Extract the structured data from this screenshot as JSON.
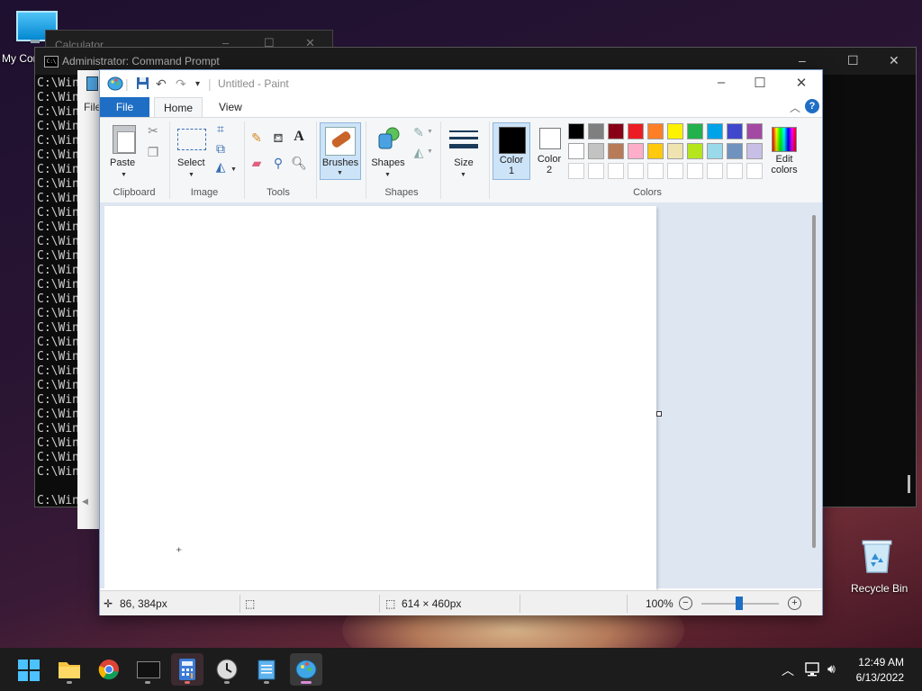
{
  "desktop": {
    "icons": [
      {
        "label": "My Computer"
      },
      {
        "label": "Recycle Bin"
      }
    ]
  },
  "background_windows": {
    "calculator": {
      "title": "Calculator"
    },
    "command_prompt": {
      "title": "Administrator: Command Prompt",
      "line_text": "C:\\Windows\\System32",
      "line_count": 28,
      "last_line": "C:\\Windows\\System32>"
    },
    "notepad": {
      "menu_file": "File"
    }
  },
  "paint": {
    "title": "Untitled - Paint",
    "tabs": {
      "file": "File",
      "home": "Home",
      "view": "View"
    },
    "groups": {
      "clipboard": "Clipboard",
      "image": "Image",
      "tools": "Tools",
      "shapes": "Shapes",
      "colors": "Colors"
    },
    "buttons": {
      "paste": "Paste",
      "select": "Select",
      "brushes": "Brushes",
      "shapes": "Shapes",
      "size": "Size",
      "color1": "Color\n1",
      "color1_line1": "Color",
      "color1_line2": "1",
      "color2_line1": "Color",
      "color2_line2": "2",
      "edit_colors_line1": "Edit",
      "edit_colors_line2": "colors"
    },
    "palette": [
      [
        "#000000",
        "#7f7f7f",
        "#880015",
        "#ed1c24",
        "#ff7f27",
        "#fff200",
        "#22b14c",
        "#00a2e8",
        "#3f48cc",
        "#a349a4"
      ],
      [
        "#ffffff",
        "#c3c3c3",
        "#b97a57",
        "#ffaec9",
        "#ffc90e",
        "#efe4b0",
        "#b5e61d",
        "#99d9ea",
        "#7092be",
        "#c8bfe7"
      ],
      [
        "#ffffff",
        "#ffffff",
        "#ffffff",
        "#ffffff",
        "#ffffff",
        "#ffffff",
        "#ffffff",
        "#ffffff",
        "#ffffff",
        "#ffffff"
      ]
    ],
    "primary_color": "#000000",
    "secondary_color": "#ffffff",
    "status": {
      "cursor_position": "86, 384px",
      "canvas_size": "614 × 460px",
      "zoom": "100%"
    },
    "zoom_level": 100
  },
  "taskbar": {
    "apps": [
      "start",
      "file-explorer",
      "chrome",
      "terminal",
      "calculator",
      "clock",
      "notepad",
      "paint"
    ],
    "clock_time": "12:49 AM",
    "clock_date": "6/13/2022"
  },
  "accent_color": "#1f6ec5"
}
